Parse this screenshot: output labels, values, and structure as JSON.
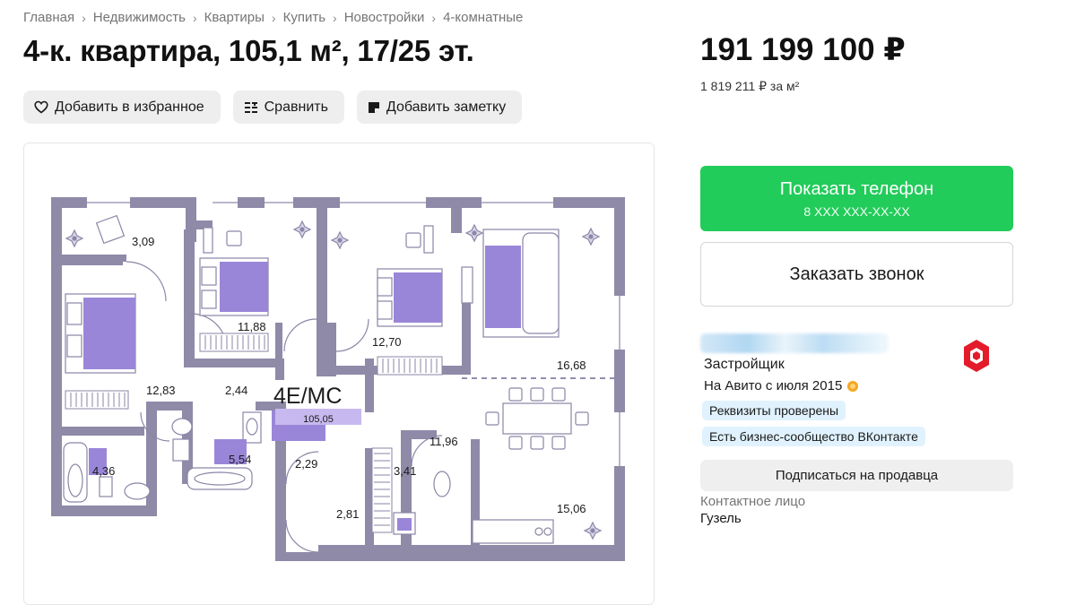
{
  "breadcrumbs": [
    "Главная",
    "Недвижимость",
    "Квартиры",
    "Купить",
    "Новостройки",
    "4-комнатные"
  ],
  "listing": {
    "title": "4-к. квартира, 105,1 м², 17/25 эт.",
    "price": "191 199 100 ₽",
    "price_per_m2": "1 819 211 ₽ за м²"
  },
  "actions": {
    "favorite": "Добавить в избранное",
    "compare": "Сравнить",
    "note": "Добавить заметку"
  },
  "contact": {
    "phone_label": "Показать телефон",
    "phone_number": "8 XXX XXX-XX-XX",
    "callback": "Заказать звонок"
  },
  "seller": {
    "type": "Застройщик",
    "on_avito": "На Авито с июля 2015",
    "badges": [
      "Реквизиты проверены",
      "Есть бизнес-сообщество ВКонтакте"
    ],
    "subscribe": "Подписаться на продавца",
    "contact_label": "Контактное лицо",
    "contact_name": "Гузель"
  },
  "floorplan": {
    "code": "4Е/МС",
    "total_area": "105,05",
    "rooms": [
      "3,09",
      "11,88",
      "12,70",
      "16,68",
      "12,83",
      "2,44",
      "4,36",
      "5,54",
      "2,29",
      "3,41",
      "11,96",
      "2,81",
      "15,06"
    ]
  },
  "colors": {
    "accent_green": "#22cc5a",
    "badge_bg": "#e0f2fd",
    "wall": "#8e8aa8",
    "furniture": "#9a86d8"
  }
}
